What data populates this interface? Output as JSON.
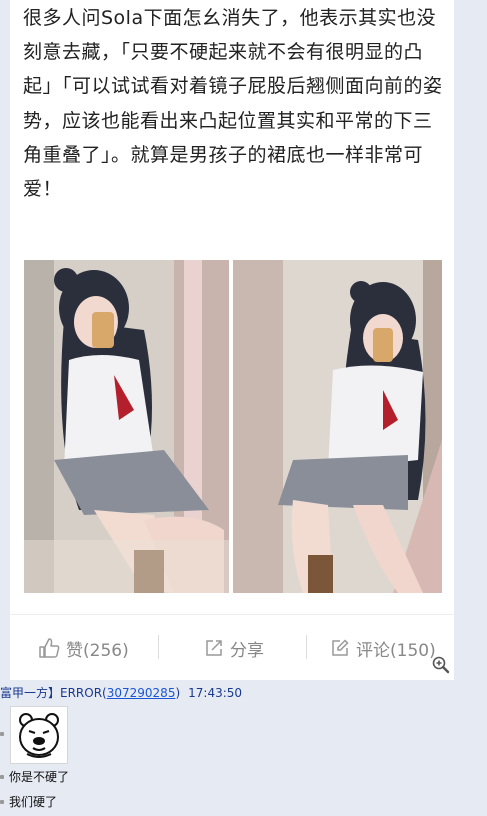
{
  "article": {
    "paragraph": "很多人问Sola下面怎幺消失了，他表示其实也没刻意去藏，「只要不硬起来就不会有很明显的凸起」「可以试试看对着镜子屁股后翘侧面向前的姿势，应该也能看出来凸起位置其实和平常的下三角重叠了」。就算是男孩子的裙底也一样非常可爱！"
  },
  "actions": {
    "like_label": "赞(256)",
    "share_label": "分享",
    "comment_label": "评论(150)"
  },
  "chat": {
    "sender": "富甲一方】ERROR(",
    "uid": "307290285",
    "uid_close": ")",
    "time": "17:43:50",
    "messages": [
      "你是不硬了",
      "我们硬了"
    ]
  },
  "colors": {
    "page_bg": "#e6eaf3",
    "card_bg": "#ffffff",
    "action_text": "#888888",
    "chat_name": "#1a3a8f"
  }
}
